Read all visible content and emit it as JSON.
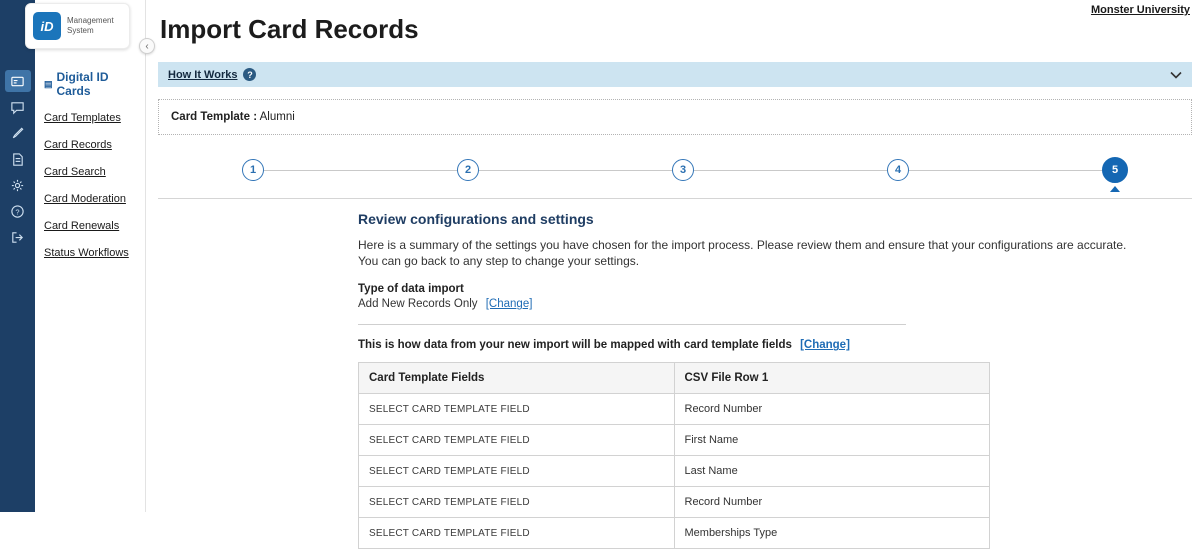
{
  "colors": {
    "sidebar": "#1d3f66",
    "accent": "#1467b3",
    "hiw_bg": "#cde4f1"
  },
  "logo": {
    "brand": "iD",
    "line1": "Management",
    "line2": "System"
  },
  "header": {
    "title": "Import Card Records",
    "account_link": "Monster University"
  },
  "sidebar": {
    "collapse_glyph": "‹",
    "section_title": "Digital ID Cards",
    "section_icon_glyph": "▤",
    "items": [
      {
        "label": "Card Templates"
      },
      {
        "label": "Card Records"
      },
      {
        "label": "Card Search"
      },
      {
        "label": "Card Moderation"
      },
      {
        "label": "Card Renewals"
      },
      {
        "label": "Status Workflows"
      }
    ],
    "icons": [
      "id-cards-icon",
      "chat-icon",
      "design-icon",
      "documents-icon",
      "settings-icon",
      "help-icon",
      "logout-icon"
    ]
  },
  "how_it_works": {
    "label": "How It Works",
    "help_glyph": "?"
  },
  "card_template": {
    "label": "Card Template :",
    "value": "Alumni"
  },
  "stepper": {
    "steps": [
      "1",
      "2",
      "3",
      "4",
      "5"
    ],
    "active_step": "5"
  },
  "review": {
    "heading": "Review configurations and settings",
    "desc1": "Here is a summary of the settings you have chosen for the import process. Please review them and ensure that your configurations are accurate.",
    "desc2": "You can go back to any step to change your settings.",
    "type_label": "Type of data import",
    "type_value": "Add New Records Only",
    "change_link": "[Change]",
    "mapping_label": "This is how data from your new import will be mapped with card template fields",
    "mapping_change_link": "[Change]"
  },
  "table": {
    "headers": [
      "Card Template Fields",
      "CSV File Row 1"
    ],
    "rows": [
      [
        "SELECT CARD TEMPLATE FIELD",
        "Record Number"
      ],
      [
        "SELECT CARD TEMPLATE FIELD",
        "First Name"
      ],
      [
        "SELECT CARD TEMPLATE FIELD",
        "Last Name"
      ],
      [
        "SELECT CARD TEMPLATE FIELD",
        "Record Number"
      ],
      [
        "SELECT CARD TEMPLATE FIELD",
        "Memberships Type"
      ]
    ]
  }
}
